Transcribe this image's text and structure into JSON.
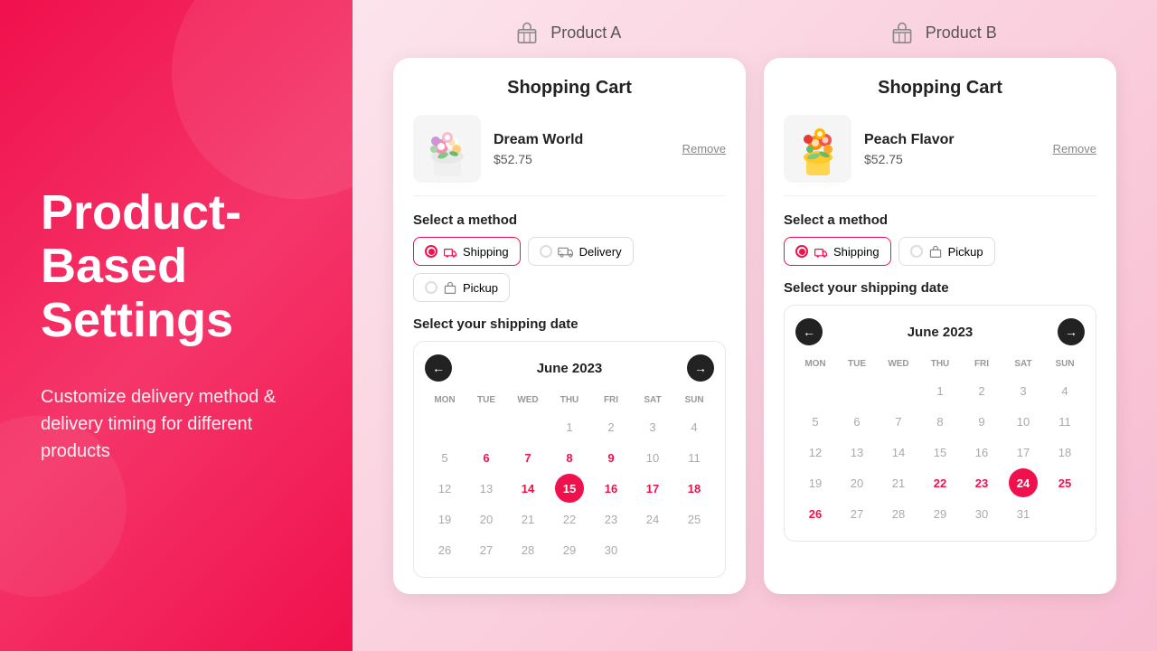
{
  "hero": {
    "title": "Product-Based Settings",
    "subtitle": "Customize delivery method & delivery timing for different products"
  },
  "products": [
    {
      "id": "product-a",
      "label": "Product A",
      "card": {
        "title": "Shopping Cart",
        "item": {
          "name": "Dream World",
          "price": "$52.75",
          "remove_label": "Remove"
        },
        "select_method_label": "Select a method",
        "methods": [
          {
            "id": "shipping",
            "label": "Shipping",
            "active": true
          },
          {
            "id": "delivery",
            "label": "Delivery",
            "active": false
          },
          {
            "id": "pickup",
            "label": "Pickup",
            "active": false
          }
        ],
        "shipping_date_label": "Select your shipping date",
        "calendar": {
          "month": "June 2023",
          "days_of_week": [
            "MON",
            "TUE",
            "WED",
            "THU",
            "FRI",
            "SAT",
            "SUN"
          ],
          "leading_empty": 3,
          "total_days": 30,
          "active_days": [
            6,
            7,
            8,
            9,
            14,
            15,
            16,
            17,
            18
          ],
          "selected_day": 15
        }
      }
    },
    {
      "id": "product-b",
      "label": "Product B",
      "card": {
        "title": "Shopping Cart",
        "item": {
          "name": "Peach Flavor",
          "price": "$52.75",
          "remove_label": "Remove"
        },
        "select_method_label": "Select a method",
        "methods": [
          {
            "id": "shipping",
            "label": "Shipping",
            "active": true
          },
          {
            "id": "pickup",
            "label": "Pickup",
            "active": false
          }
        ],
        "shipping_date_label": "Select your shipping date",
        "calendar": {
          "month": "June 2023",
          "days_of_week": [
            "MON",
            "TUE",
            "WED",
            "THU",
            "FRI",
            "SAT",
            "SUN"
          ],
          "leading_empty": 3,
          "total_days": 31,
          "active_days": [
            22,
            23,
            24,
            25,
            26
          ],
          "selected_day": 24
        }
      }
    }
  ]
}
